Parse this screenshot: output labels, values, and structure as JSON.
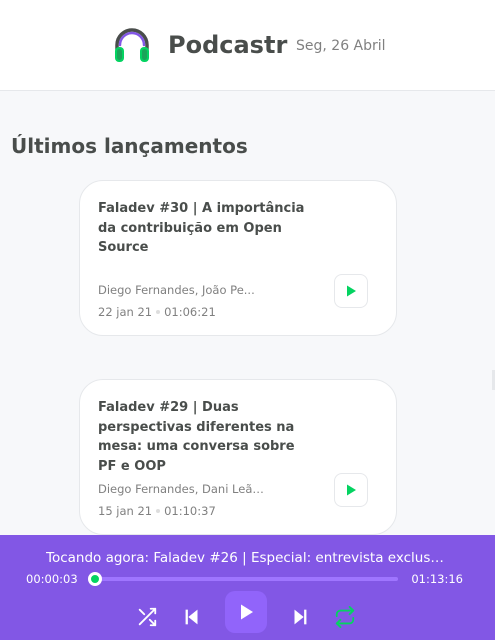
{
  "header": {
    "logo_icon": "headphones-icon",
    "app_name": "Podcastr",
    "date": "Seg, 26 Abril"
  },
  "latest": {
    "title": "Últimos lançamentos",
    "episodes": [
      {
        "title": "Faladev #30 | A importância da contribuição em Open Source",
        "members": "Diego Fernandes, João Pe...",
        "date": "22 jan 21",
        "duration": "01:06:21",
        "play_icon": "play-icon"
      },
      {
        "title": "Faladev #29 | Duas perspectivas diferentes na mesa: uma conversa sobre PF e OOP",
        "members": "Diego Fernandes, Dani Leão...",
        "date": "15 jan 21",
        "duration": "01:10:37",
        "play_icon": "play-icon"
      }
    ]
  },
  "player": {
    "now_playing": "Tocando agora: Faladev #26 | Especial: entrevista exclusiv...",
    "elapsed": "00:00:03",
    "total": "01:13:16",
    "progress_fraction": 0.0007,
    "controls": [
      "shuffle-icon",
      "previous-icon",
      "play-icon",
      "next-icon",
      "repeat-icon"
    ]
  },
  "colors": {
    "accent": "#8257e5",
    "green": "#04d361",
    "text": "#494d4b",
    "muted": "#808080"
  }
}
